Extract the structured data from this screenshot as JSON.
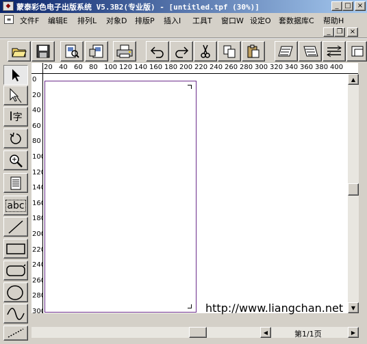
{
  "window": {
    "title": "蒙泰彩色电子出版系统 V5.3B2(专业版) - [untitled.tpf (30%)]",
    "minimize": "_",
    "maximize": "□",
    "close": "×",
    "child_minimize": "_",
    "child_restore": "❐",
    "child_close": "×"
  },
  "menu": {
    "file": "文件F",
    "edit": "编辑E",
    "arrange": "排列L",
    "object": "对象D",
    "layout": "排版P",
    "insert": "插入I",
    "tools": "工具T",
    "window": "窗口W",
    "settings": "设定O",
    "database": "套数据库C",
    "help": "帮助H"
  },
  "toolbar_icons": [
    "open-icon",
    "save-icon",
    "print-preview-icon",
    "page-setup-icon",
    "printer-icon",
    "undo-icon",
    "redo-icon",
    "cut-icon",
    "copy-icon",
    "paste-icon",
    "text-flow-icon",
    "text-flow-2-icon",
    "text-flow-3-icon",
    "text-flow-4-icon"
  ],
  "left_tools": {
    "text_tool_label": "字",
    "abc_label": "abc"
  },
  "ruler": {
    "h_labels": [
      "20",
      "40",
      "60",
      "80",
      "100",
      "120",
      "140",
      "160",
      "180",
      "200",
      "220",
      "240",
      "260",
      "280",
      "300",
      "320",
      "340",
      "360",
      "380",
      "400"
    ],
    "v_labels": [
      "0",
      "20",
      "40",
      "60",
      "80",
      "100",
      "120",
      "140",
      "160",
      "180",
      "200",
      "220",
      "240",
      "260",
      "280",
      "300"
    ]
  },
  "statusbar": {
    "page_indicator": "第1/1页"
  },
  "watermark": "http://www.liangchan.net"
}
